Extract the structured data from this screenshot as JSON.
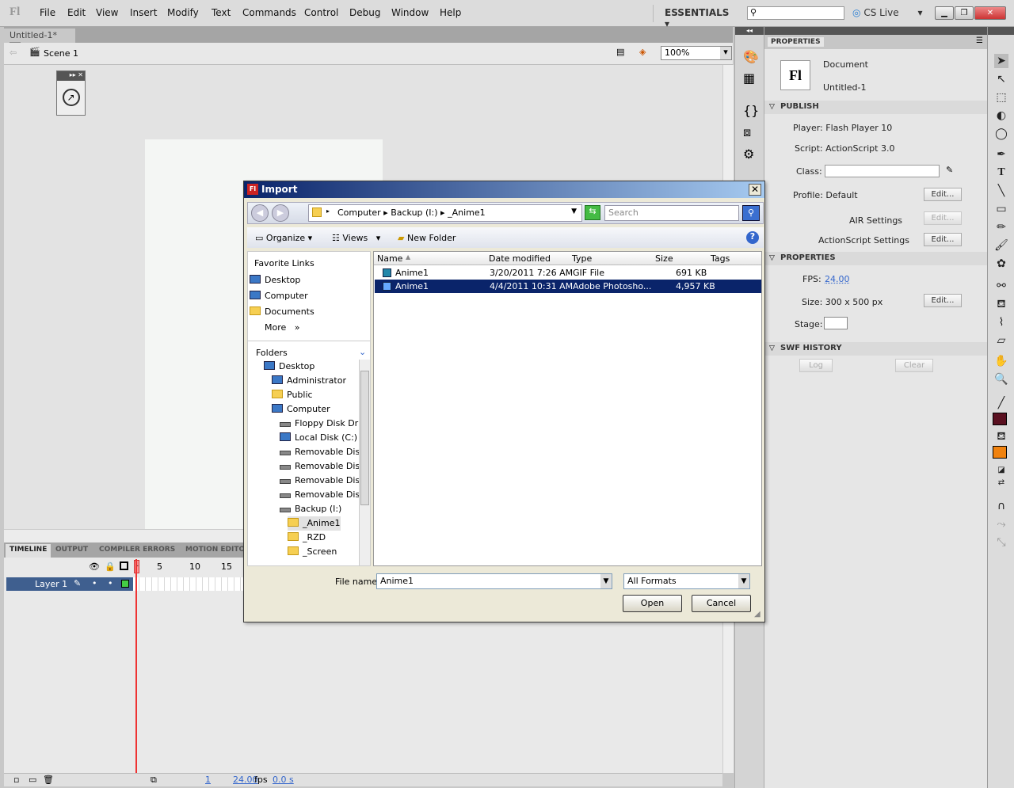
{
  "app": {
    "logo": "Fl",
    "workspace": "ESSENTIALS",
    "cs_live": "CS Live"
  },
  "menu": [
    "File",
    "Edit",
    "View",
    "Insert",
    "Modify",
    "Text",
    "Commands",
    "Control",
    "Debug",
    "Window",
    "Help"
  ],
  "document": {
    "tab": "Untitled-1*",
    "scene": "Scene 1",
    "zoom": "100%"
  },
  "timeline": {
    "tabs": [
      "TIMELINE",
      "OUTPUT",
      "COMPILER ERRORS",
      "MOTION EDITO"
    ],
    "frame_numbers": [
      "1",
      "5",
      "10",
      "15"
    ],
    "layer": "Layer 1",
    "footer": {
      "frame": "1",
      "fps": "24.00",
      "fps_unit": "fps",
      "time": "0.0 s"
    }
  },
  "properties": {
    "header": "PROPERTIES",
    "doc_type": "Document",
    "doc_name": "Untitled-1",
    "publish": {
      "title": "PUBLISH",
      "player": "Player: Flash Player 10",
      "script": "Script: ActionScript 3.0",
      "class_label": "Class:",
      "class_value": "",
      "profile": "Profile: Default",
      "edit": "Edit...",
      "air": "AIR Settings",
      "as_settings": "ActionScript Settings"
    },
    "props": {
      "title": "PROPERTIES",
      "fps_label": "FPS:",
      "fps": "24.00",
      "size": "Size: 300 x 500 px",
      "stage_label": "Stage:"
    },
    "swf": {
      "title": "SWF HISTORY",
      "log": "Log",
      "clear": "Clear"
    }
  },
  "dialog": {
    "title": "Import",
    "breadcrumb": [
      "Computer",
      "Backup (I:)",
      "_Anime1"
    ],
    "search_placeholder": "Search",
    "organize": "Organize",
    "views": "Views",
    "new_folder": "New Folder",
    "favorite_links_title": "Favorite Links",
    "favorites": [
      "Desktop",
      "Computer",
      "Documents",
      "More"
    ],
    "folders_title": "Folders",
    "folders": [
      {
        "name": "Desktop",
        "icon": "monitor"
      },
      {
        "name": "Administrator",
        "icon": "user"
      },
      {
        "name": "Public",
        "icon": "folder"
      },
      {
        "name": "Computer",
        "icon": "monitor"
      },
      {
        "name": "Floppy Disk Drive",
        "icon": "floppy"
      },
      {
        "name": "Local Disk (C:)",
        "icon": "disk"
      },
      {
        "name": "Removable Disk",
        "icon": "drive"
      },
      {
        "name": "Removable Disk",
        "icon": "drive"
      },
      {
        "name": "Removable Disk",
        "icon": "drive"
      },
      {
        "name": "Removable Disk",
        "icon": "drive"
      },
      {
        "name": "Backup (I:)",
        "icon": "drive"
      },
      {
        "name": "_Anime1",
        "icon": "folder"
      },
      {
        "name": "_RZD",
        "icon": "folder"
      },
      {
        "name": "_Screen",
        "icon": "folder"
      }
    ],
    "columns": [
      "Name",
      "Date modified",
      "Type",
      "Size",
      "Tags"
    ],
    "files": [
      {
        "name": "Anime1",
        "date": "3/20/2011 7:26 AM",
        "type": "GIF File",
        "size": "691 KB",
        "selected": false
      },
      {
        "name": "Anime1",
        "date": "4/4/2011 10:31 AM",
        "type": "Adobe Photosho...",
        "size": "4,957 KB",
        "selected": true
      }
    ],
    "file_name_label": "File name:",
    "file_name": "Anime1",
    "format": "All Formats",
    "open": "Open",
    "cancel": "Cancel"
  },
  "colors": {
    "stroke": "#5a1020",
    "fill": "#f0820f",
    "selection": "#0a246a"
  }
}
